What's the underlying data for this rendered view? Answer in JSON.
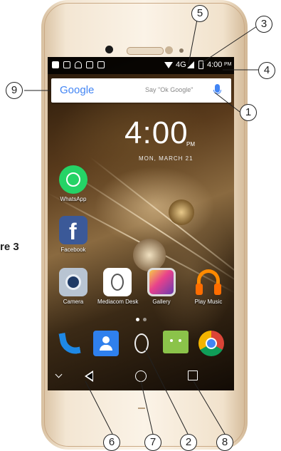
{
  "status_bar": {
    "time": "4:00",
    "ampm": "PM",
    "network": "4G"
  },
  "search": {
    "brand": "Google",
    "hint": "Say \"Ok Google\""
  },
  "clock": {
    "time": "4:00",
    "ampm": "PM",
    "date": "MON, MARCH 21"
  },
  "apps": [
    {
      "label": "WhatsApp",
      "color": "#25d366"
    },
    {
      "label": "Facebook",
      "color": "#3b5998"
    },
    {
      "label": "Camera",
      "color": "#8a9bb0"
    },
    {
      "label": "Mediacom Desk",
      "color": "#ffffff"
    },
    {
      "label": "Gallery",
      "color": "#6a3db0"
    },
    {
      "label": "Play Music",
      "color": "#ff8a00"
    }
  ],
  "dock": [
    "Phone",
    "Contacts",
    "Mediacom",
    "Messages",
    "Chrome"
  ],
  "callouts": [
    "1",
    "2",
    "3",
    "4",
    "5",
    "6",
    "7",
    "8",
    "9"
  ],
  "figure_label": "re 3"
}
